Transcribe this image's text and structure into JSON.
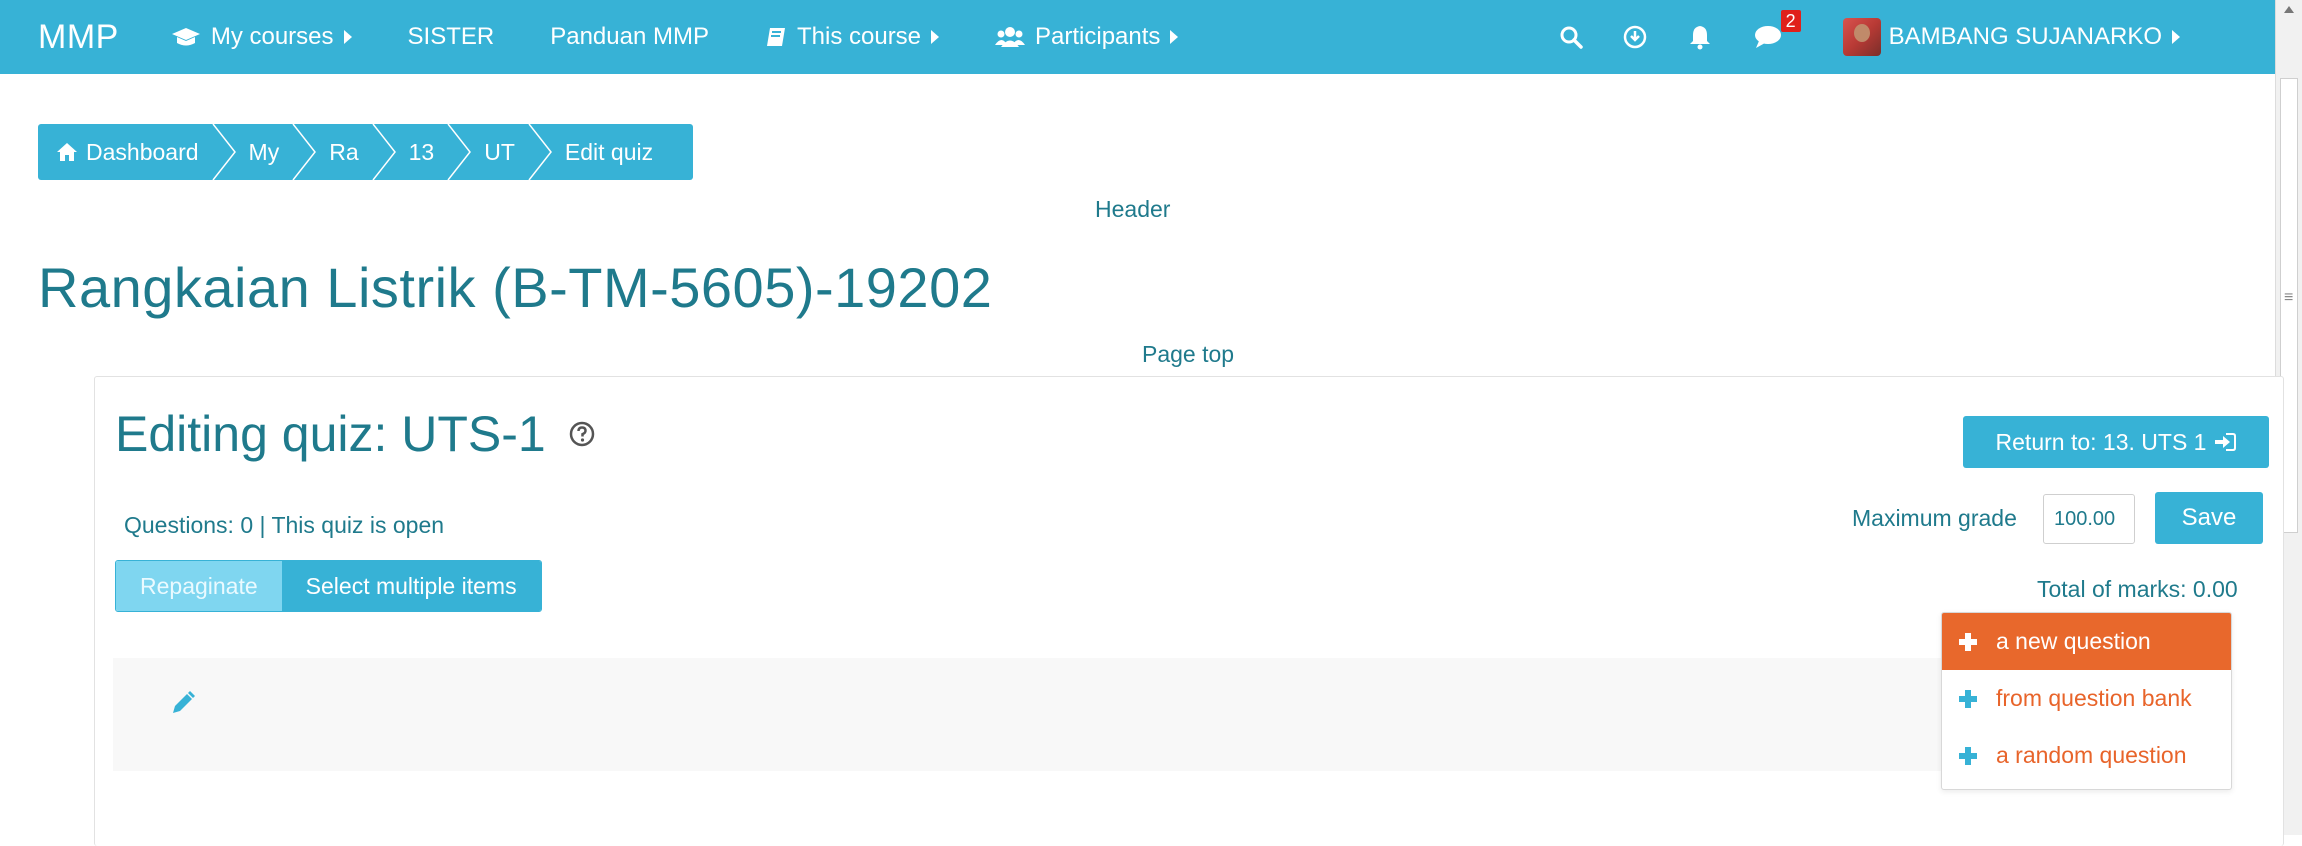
{
  "navbar": {
    "brand": "MMP",
    "items": [
      {
        "label": "My courses",
        "icon": "graduation-cap-icon",
        "dropdown": true
      },
      {
        "label": "SISTER",
        "icon": "",
        "dropdown": false
      },
      {
        "label": "Panduan MMP",
        "icon": "",
        "dropdown": false
      },
      {
        "label": "This course",
        "icon": "book-icon",
        "dropdown": true
      },
      {
        "label": "Participants",
        "icon": "users-icon",
        "dropdown": true
      }
    ],
    "notification_count": "2",
    "user_name": "BAMBANG SUJANARKO",
    "color": "#37b2d6"
  },
  "breadcrumb": [
    "Dashboard",
    "My",
    "Ra",
    "13",
    "UT",
    "Edit quiz"
  ],
  "page": {
    "header_label": "Header",
    "title": "Rangkaian Listrik (B-TM-5605)-19202",
    "page_top_label": "Page top"
  },
  "quiz": {
    "title": "Editing quiz: UTS-1",
    "return_label": "Return to: 13. UTS 1",
    "questions_info": "Questions: 0 | This quiz is open",
    "max_grade_label": "Maximum grade",
    "max_grade_value": "100.00",
    "save_label": "Save",
    "repaginate_label": "Repaginate",
    "select_multiple_label": "Select multiple items",
    "total_marks": "Total of marks: 0.00"
  },
  "add_menu": {
    "items": [
      {
        "label": "a new question",
        "active": true
      },
      {
        "label": "from question bank",
        "active": false
      },
      {
        "label": "a random question",
        "active": false
      }
    ],
    "accent": "#e8682c"
  }
}
